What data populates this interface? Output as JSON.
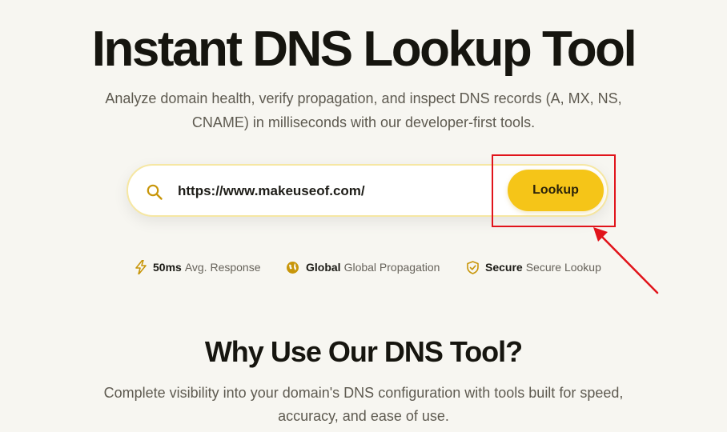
{
  "hero": {
    "title": "Instant DNS Lookup Tool",
    "subtitle": "Analyze domain health, verify propagation, and inspect DNS records (A, MX, NS, CNAME) in milliseconds with our developer-first tools."
  },
  "search": {
    "value": "https://www.makeuseof.com/",
    "button_label": "Lookup"
  },
  "stats": [
    {
      "icon": "lightning-icon",
      "bold": "50ms",
      "text": "Avg. Response"
    },
    {
      "icon": "globe-icon",
      "bold": "Global",
      "text": "Global Propagation"
    },
    {
      "icon": "shield-check-icon",
      "bold": "Secure",
      "text": "Secure Lookup"
    }
  ],
  "why": {
    "title": "Why Use Our DNS Tool?",
    "subtitle": "Complete visibility into your domain's DNS configuration with tools built for speed, accuracy, and ease of use."
  },
  "colors": {
    "background": "#f7f6f1",
    "accent": "#f5c518",
    "icon_accent": "#c8960a",
    "annotation": "#e1141b"
  }
}
